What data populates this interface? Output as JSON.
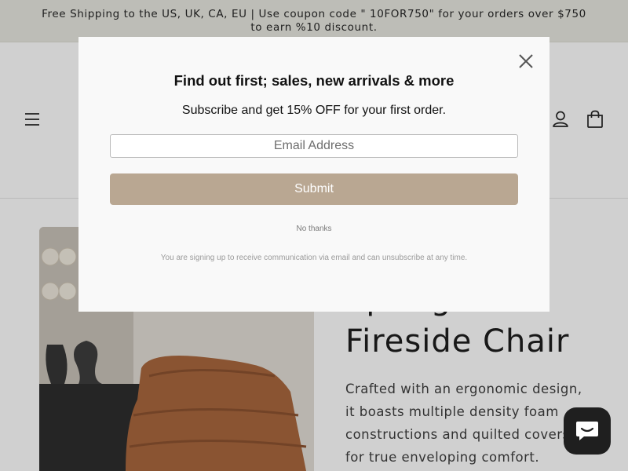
{
  "announcement": {
    "text": "Free Shipping to the US, UK, CA, EU | Use coupon code \" 10FOR750\" for your orders over $750 to earn %10 discount."
  },
  "header": {
    "menu_icon": "hamburger-menu-icon",
    "account_icon": "account-icon",
    "cart_icon": "cart-icon"
  },
  "product": {
    "title_line1": "Springtime",
    "title_line2": "Fireside Chair",
    "description": "Crafted with an ergonomic design, it boasts multiple density foam constructions and quilted covers for true enveloping comfort."
  },
  "popup": {
    "title": "Find out first; sales, new arrivals & more",
    "subtitle": "Subscribe and get 15% OFF for your first order.",
    "email_placeholder": "Email Address",
    "submit_label": "Submit",
    "no_thanks": "No thanks",
    "disclaimer": "You are signing up to receive communication via email and can unsubscribe at any time.",
    "close_icon": "close-icon"
  },
  "chat": {
    "icon": "chat-bubble-icon"
  },
  "colors": {
    "announcement_bg": "#e8e8e0",
    "submit_bg": "#b9a792",
    "chat_bg": "#1f1f1f"
  }
}
